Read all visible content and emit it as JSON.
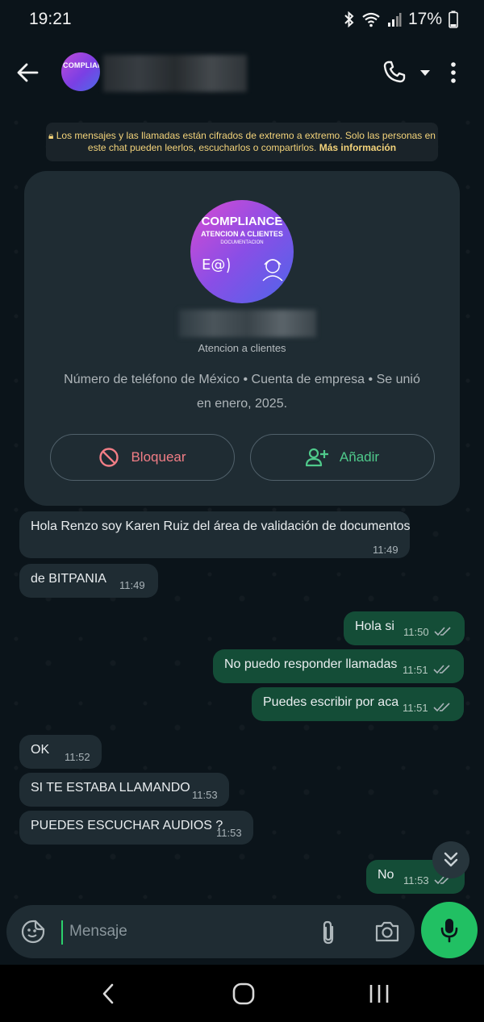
{
  "status_bar": {
    "time": "19:21",
    "battery": "17%"
  },
  "header": {
    "avatar_text": "COMPLIANCE",
    "icons": [
      "back-arrow-icon",
      "phone-icon",
      "caret-down-icon",
      "more-vert-icon"
    ]
  },
  "encryption_notice": {
    "text": "Los mensajes y las llamadas están cifrados de extremo a extremo. Solo las personas en este chat pueden leerlos, escucharlos o compartirlos.",
    "link": "Más información"
  },
  "profile_card": {
    "avatar_line1": "COMPLIANCE",
    "avatar_line2": "ATENCION A CLIENTES",
    "avatar_line3": "DOCUMENTACION",
    "subtitle": "Atencion a clientes",
    "description": "Número de teléfono de México • Cuenta de empresa • Se unió en enero, 2025.",
    "block_label": "Bloquear",
    "add_label": "Añadir",
    "colors": {
      "block": "#f27e86",
      "add": "#4fc98b"
    }
  },
  "messages": [
    {
      "dir": "in",
      "text": "Hola Renzo  soy Karen Ruiz del área de validación de documentos",
      "time": "11:49"
    },
    {
      "dir": "in",
      "text": "de BITPANIA",
      "time": "11:49"
    },
    {
      "dir": "out",
      "text": "Hola si",
      "time": "11:50"
    },
    {
      "dir": "out",
      "text": "No puedo responder llamadas",
      "time": "11:51"
    },
    {
      "dir": "out",
      "text": "Puedes escribir por aca",
      "time": "11:51"
    },
    {
      "dir": "in",
      "text": "OK",
      "time": "11:52"
    },
    {
      "dir": "in",
      "text": "SI TE ESTABA LLAMANDO",
      "time": "11:53"
    },
    {
      "dir": "in",
      "text": "PUEDES ESCUCHAR AUDIOS ?",
      "time": "11:53"
    },
    {
      "dir": "out",
      "text": "No",
      "time": "11:53"
    }
  ],
  "composer": {
    "placeholder": "Mensaje"
  },
  "theme": {
    "background": "#0b141a",
    "incoming": "#1f2c33",
    "outgoing": "#144d37",
    "accent": "#21c063"
  }
}
